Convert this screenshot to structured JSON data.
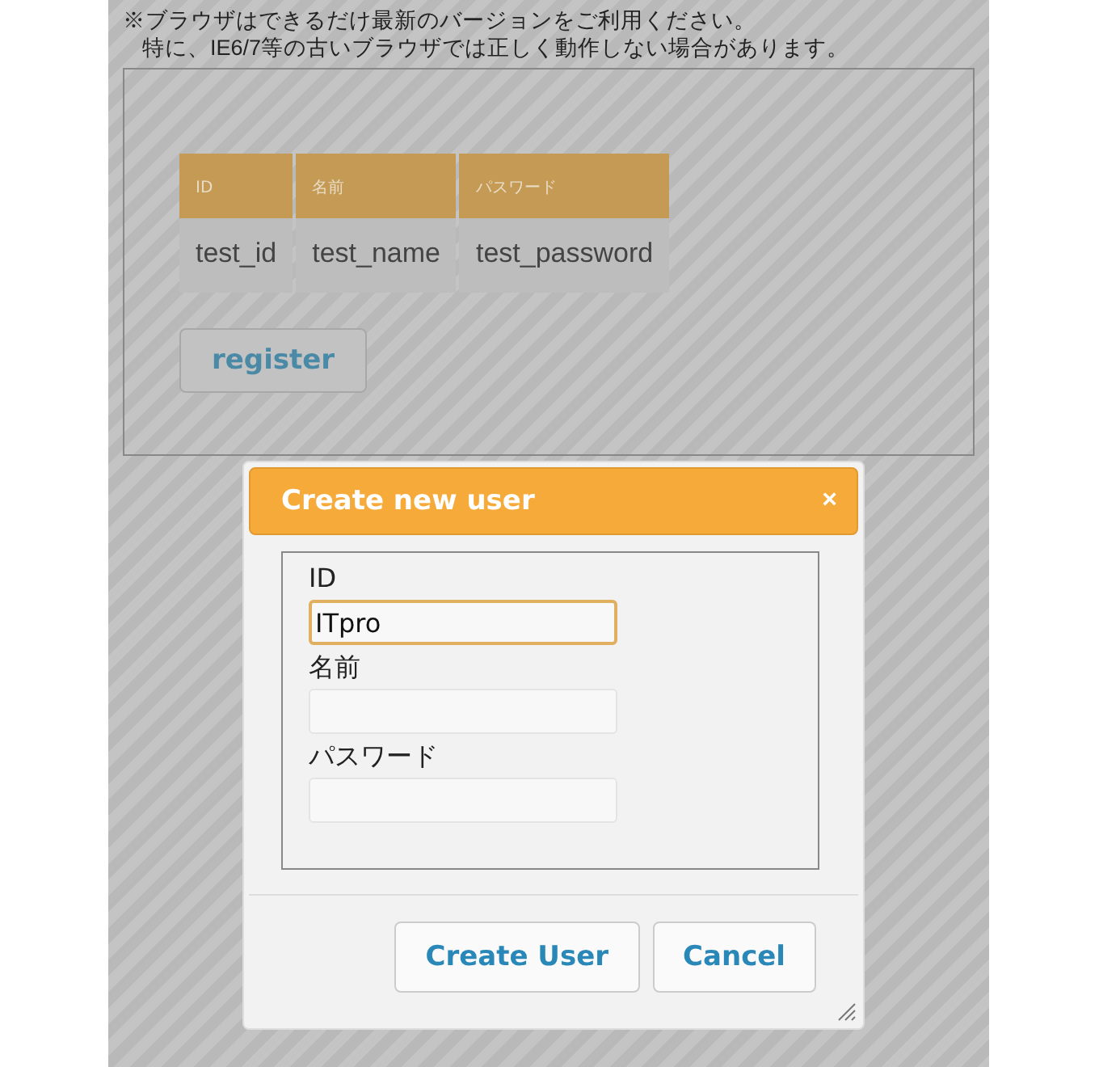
{
  "notice": [
    "※ブラウザはできるだけ最新のバージョンをご利用ください。",
    "特に、IE6/7等の古いブラウザでは正しく動作しない場合があります。"
  ],
  "table": {
    "columns": [
      "ID",
      "名前",
      "パスワード"
    ],
    "rows": [
      [
        "test_id",
        "test_name",
        "test_password"
      ]
    ]
  },
  "register_button": "register",
  "dialog": {
    "title": "Create new user",
    "close": "×",
    "fields": [
      {
        "label": "ID",
        "value": "ITpro",
        "focused": true
      },
      {
        "label": "名前",
        "focused": false
      },
      {
        "label": "パスワード",
        "focused": false
      }
    ],
    "buttons": [
      "Create User",
      "Cancel"
    ]
  }
}
